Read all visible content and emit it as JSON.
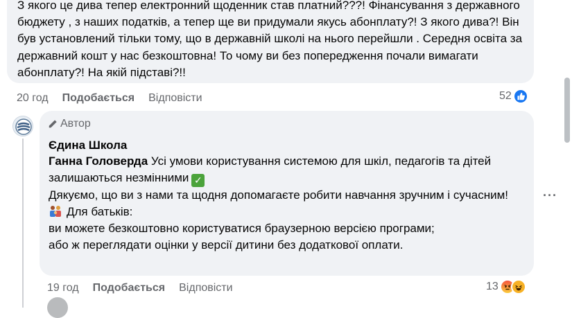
{
  "comment1": {
    "text": "З якого це дива тепер електронний щоденник став платний???! Фінансування з державного бюджету , з наших податків, а тепер ще ви придумали якусь абонплату?! З якого дива?! Він був установлений тільки тому, що в державній школі на нього перейшли . Середня освіта за державний кошт у нас безкоштовна! То чому ви без попередження почали вимагати абонплату?! На якій підставі?!!",
    "time": "20 год",
    "like_label": "Подобається",
    "reply_label": "Відповісти",
    "reaction_count": "52",
    "reactions": [
      "like-icon"
    ]
  },
  "reply": {
    "badge": "Автор",
    "page_name": "Єдина Школа",
    "mention": "Ганна Головерда",
    "line1": " Усі умови користування системою для шкіл, педагогів та дітей залишаються незмінними",
    "line2": "Дякуємо, що ви з нами та щодня допомагаєте робити навчання зручним і сучасним!",
    "line3": "Для батьків:",
    "line4": "ви можете безкоштовно користуватися браузерною версією програми;",
    "line5": "або ж переглядати оцінки у версії дитини без додаткової оплати.",
    "time": "19 год",
    "like_label": "Подобається",
    "reply_label": "Відповісти",
    "reaction_count": "13",
    "reactions": [
      "angry-icon",
      "haha-icon"
    ],
    "more_label": "···"
  },
  "colors": {
    "bubble": "#f0f2f5",
    "secondary_text": "#65676b",
    "like_blue": "#1877f2"
  }
}
